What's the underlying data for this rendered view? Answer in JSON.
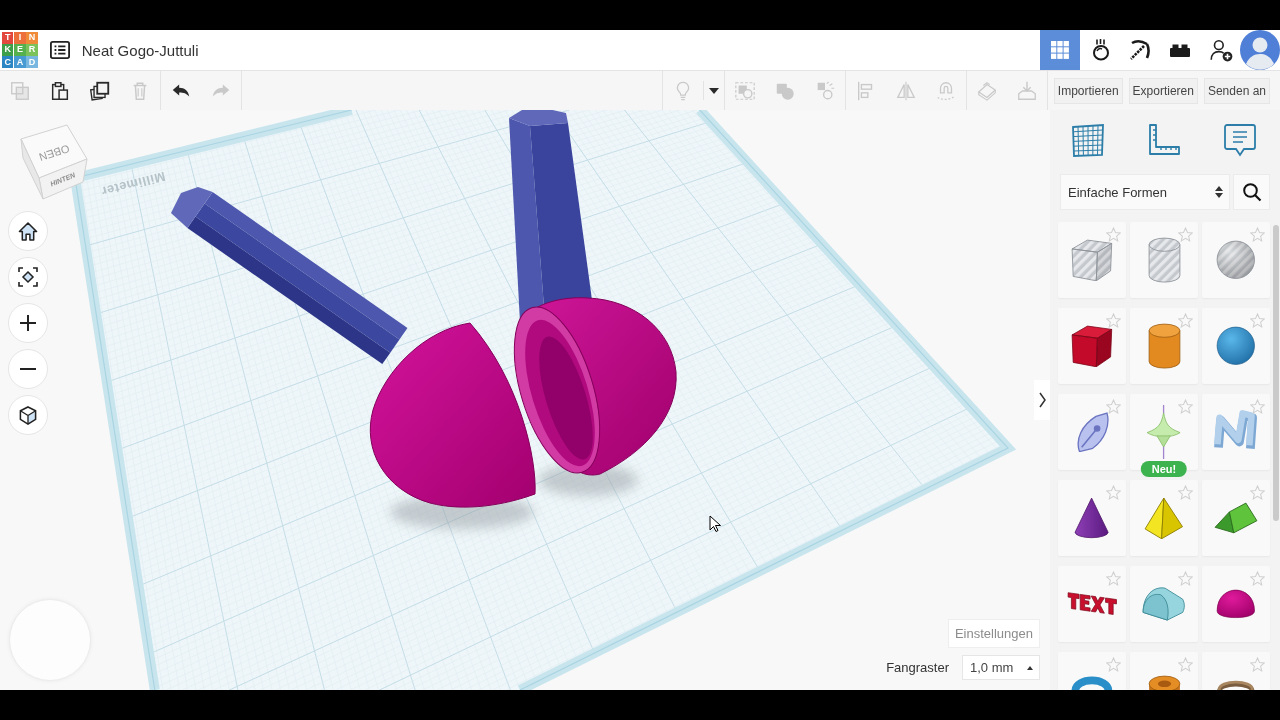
{
  "header": {
    "logo": [
      {
        "letter": "T",
        "color": "#e2483d"
      },
      {
        "letter": "I",
        "color": "#ec6f3c"
      },
      {
        "letter": "N",
        "color": "#f08b3a"
      },
      {
        "letter": "K",
        "color": "#3f9e4a"
      },
      {
        "letter": "E",
        "color": "#56b04d"
      },
      {
        "letter": "R",
        "color": "#7cc25a"
      },
      {
        "letter": "C",
        "color": "#2d86c4"
      },
      {
        "letter": "A",
        "color": "#479bd2"
      },
      {
        "letter": "D",
        "color": "#78b7df"
      }
    ],
    "title": "Neat Gogo-Juttuli",
    "apps": [
      {
        "kind": "grid",
        "selected": true
      },
      {
        "kind": "drop",
        "selected": false
      },
      {
        "kind": "pickaxe",
        "selected": false
      },
      {
        "kind": "bricks",
        "selected": false
      }
    ]
  },
  "toolbar": {
    "left": [
      [
        {
          "kind": "copy",
          "disabled": true
        },
        {
          "kind": "paste",
          "disabled": false
        },
        {
          "kind": "duplicate",
          "disabled": false
        },
        {
          "kind": "delete",
          "disabled": true
        }
      ],
      [
        {
          "kind": "undo",
          "disabled": false
        },
        {
          "kind": "redo",
          "disabled": true
        }
      ]
    ],
    "right": [
      [
        {
          "kind": "bulb",
          "disabled": true
        }
      ],
      [
        {
          "kind": "dropdown",
          "disabled": false
        }
      ],
      [
        {
          "kind": "group",
          "disabled": true
        },
        {
          "kind": "combine",
          "disabled": true
        },
        {
          "kind": "ungroup",
          "disabled": true
        }
      ],
      [
        {
          "kind": "align",
          "disabled": true
        },
        {
          "kind": "mirror",
          "disabled": true
        },
        {
          "kind": "magnet",
          "disabled": true
        }
      ],
      [
        {
          "kind": "plane",
          "disabled": true
        },
        {
          "kind": "drop",
          "disabled": true
        }
      ]
    ],
    "actions": [
      "Importieren",
      "Exportieren",
      "Senden an"
    ]
  },
  "canvas": {
    "view_cube": {
      "top": "OBEN",
      "back": "HINTEN"
    },
    "workplane": {
      "label": "Millimeter"
    },
    "settings_button": "Einstellungen",
    "snap_grid": {
      "label": "Fangraster",
      "value": "1,0 mm"
    }
  },
  "panel": {
    "category": "Einfache Formen",
    "shapes": [
      {
        "kind": "box-hole",
        "favorite": false
      },
      {
        "kind": "cylinder-hole",
        "favorite": false
      },
      {
        "kind": "sphere-hole",
        "favorite": false
      },
      {
        "kind": "box",
        "favorite": false
      },
      {
        "kind": "cylinder",
        "favorite": false
      },
      {
        "kind": "sphere",
        "favorite": false
      },
      {
        "kind": "scribble",
        "favorite": false
      },
      {
        "kind": "spinner",
        "favorite": false,
        "badge": "Neu!"
      },
      {
        "kind": "letter",
        "favorite": false
      },
      {
        "kind": "cone",
        "favorite": false
      },
      {
        "kind": "pyramid",
        "favorite": false
      },
      {
        "kind": "roof",
        "favorite": false
      },
      {
        "kind": "text",
        "favorite": false
      },
      {
        "kind": "round-roof",
        "favorite": false
      },
      {
        "kind": "dome",
        "favorite": false
      },
      {
        "kind": "torus",
        "favorite": false
      },
      {
        "kind": "tube",
        "favorite": false
      },
      {
        "kind": "ring",
        "favorite": false
      }
    ]
  }
}
